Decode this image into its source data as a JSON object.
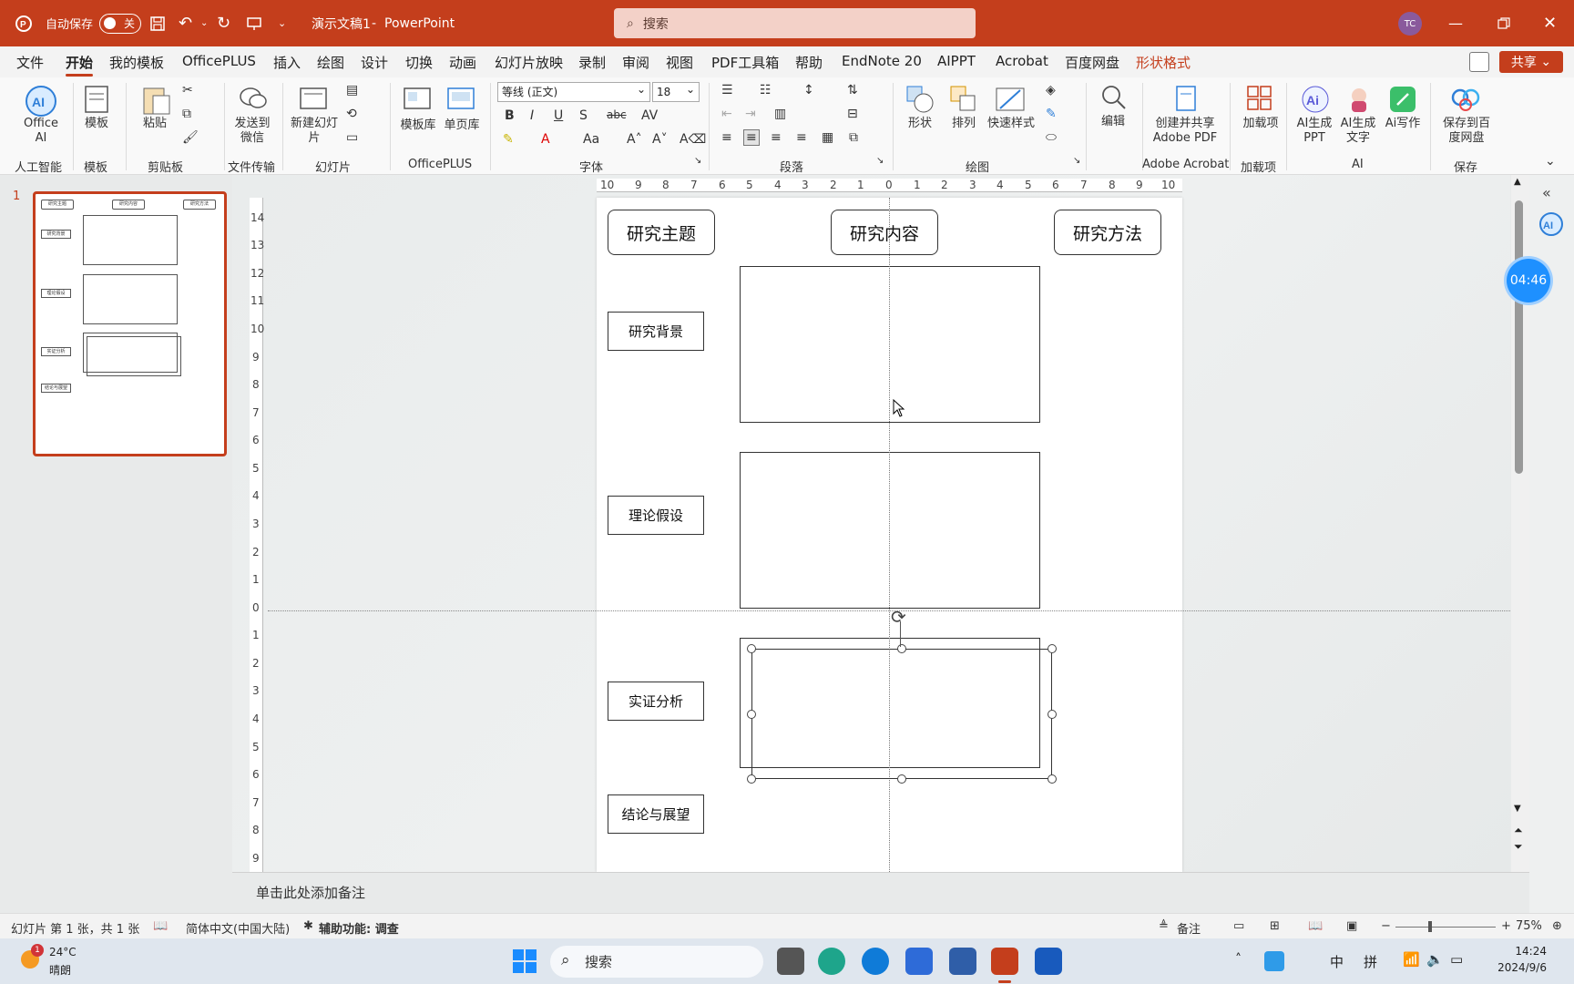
{
  "titlebar": {
    "autosave_label": "自动保存",
    "autosave_state": "关",
    "doc_title": "演示文稿1",
    "separator": "-",
    "app_name": "PowerPoint",
    "search_placeholder": "搜索",
    "user_initials": "TC"
  },
  "menu": {
    "items": [
      "文件",
      "开始",
      "我的模板",
      "OfficePLUS",
      "插入",
      "绘图",
      "设计",
      "切换",
      "动画",
      "幻灯片放映",
      "录制",
      "审阅",
      "视图",
      "PDF工具箱",
      "帮助",
      "EndNote 20",
      "AIPPT",
      "Acrobat",
      "百度网盘",
      "形状格式"
    ],
    "active": "开始",
    "share_label": "共享"
  },
  "ribbon": {
    "office_ai": "Office AI",
    "template": "模板",
    "paste": "粘贴",
    "send_wechat": "发送到微信",
    "new_slide": "新建幻灯片",
    "template_lib": "模板库",
    "single_page": "单页库",
    "font_name": "等线 (正文)",
    "font_size": "18",
    "shapes": "形状",
    "arrange": "排列",
    "quick_styles": "快速样式",
    "edit": "编辑",
    "create_share_pdf": "创建并共享 Adobe PDF",
    "addins": "加载项",
    "ai_ppt": "AI生成PPT",
    "ai_text": "AI生成文字",
    "ai_write": "Ai写作",
    "save_baidu": "保存到百度网盘",
    "groups": {
      "ai": "人工智能",
      "template": "模板",
      "clipboard": "剪贴板",
      "transfer": "文件传输",
      "slides": "幻灯片",
      "officeplus": "OfficePLUS",
      "font": "字体",
      "paragraph": "段落",
      "drawing": "绘图",
      "acrobat": "Adobe Acrobat",
      "addins": "加载项",
      "ai2": "AI",
      "save": "保存"
    }
  },
  "thumbnail": {
    "slide_number": "1"
  },
  "slide": {
    "headers": [
      "研究主题",
      "研究内容",
      "研究方法"
    ],
    "rows": [
      "研究背景",
      "理论假设",
      "实证分析",
      "结论与展望"
    ]
  },
  "rulers": {
    "horizontal": [
      "10",
      "9",
      "8",
      "7",
      "6",
      "5",
      "4",
      "3",
      "2",
      "1",
      "0",
      "1",
      "2",
      "3",
      "4",
      "5",
      "6",
      "7",
      "8",
      "9",
      "10"
    ],
    "vertical": [
      "14",
      "13",
      "12",
      "11",
      "10",
      "9",
      "8",
      "7",
      "6",
      "5",
      "4",
      "3",
      "2",
      "1",
      "0",
      "1",
      "2",
      "3",
      "4",
      "5",
      "6",
      "7",
      "8",
      "9"
    ]
  },
  "timer": "04:46",
  "notes_placeholder": "单击此处添加备注",
  "statusbar": {
    "slide_info": "幻灯片 第 1 张，共 1 张",
    "language": "简体中文(中国大陆)",
    "accessibility": "辅助功能: 调查",
    "notes_btn": "备注",
    "zoom": "75%"
  },
  "taskbar": {
    "weather_temp": "24°C",
    "weather_desc": "晴朗",
    "weather_badge": "1",
    "search_label": "搜索",
    "ime_lang": "中",
    "ime_mode": "拼",
    "time": "14:24",
    "date": "2024/9/6"
  },
  "colors": {
    "accent": "#c43e1c",
    "timer": "#1e90ff"
  }
}
